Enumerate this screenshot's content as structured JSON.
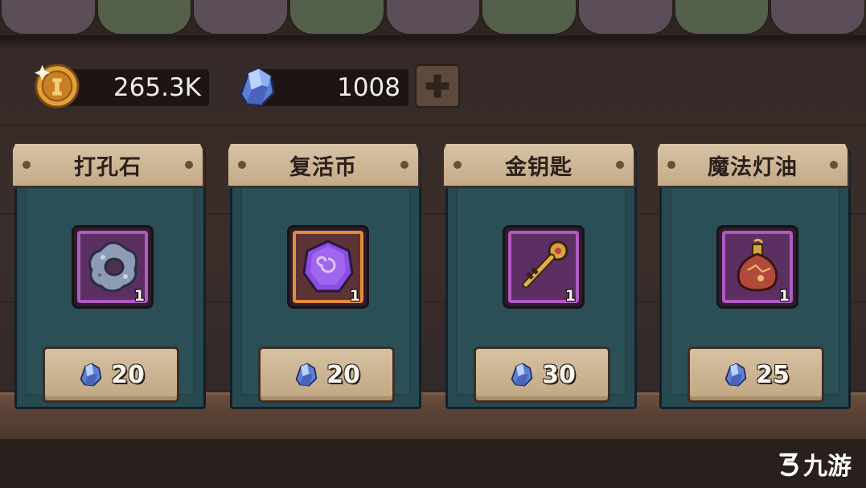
{
  "currency": {
    "coins": "265.3K",
    "gems": "1008"
  },
  "items": [
    {
      "name": "打孔石",
      "quantity": "1",
      "price": "20",
      "icon": "punch-stone-icon",
      "frame": "purple"
    },
    {
      "name": "复活币",
      "quantity": "1",
      "price": "20",
      "icon": "revive-coin-icon",
      "frame": "orange"
    },
    {
      "name": "金钥匙",
      "quantity": "1",
      "price": "30",
      "icon": "golden-key-icon",
      "frame": "purple"
    },
    {
      "name": "魔法灯油",
      "quantity": "1",
      "price": "25",
      "icon": "magic-lamp-oil-icon",
      "frame": "purple"
    }
  ],
  "watermark": "九游",
  "colors": {
    "awning_a": "#5b4e58",
    "awning_b": "#55604a",
    "card_bg": "#27494f",
    "frame_purple": "#b15ac2",
    "frame_orange": "#e48c3c"
  }
}
